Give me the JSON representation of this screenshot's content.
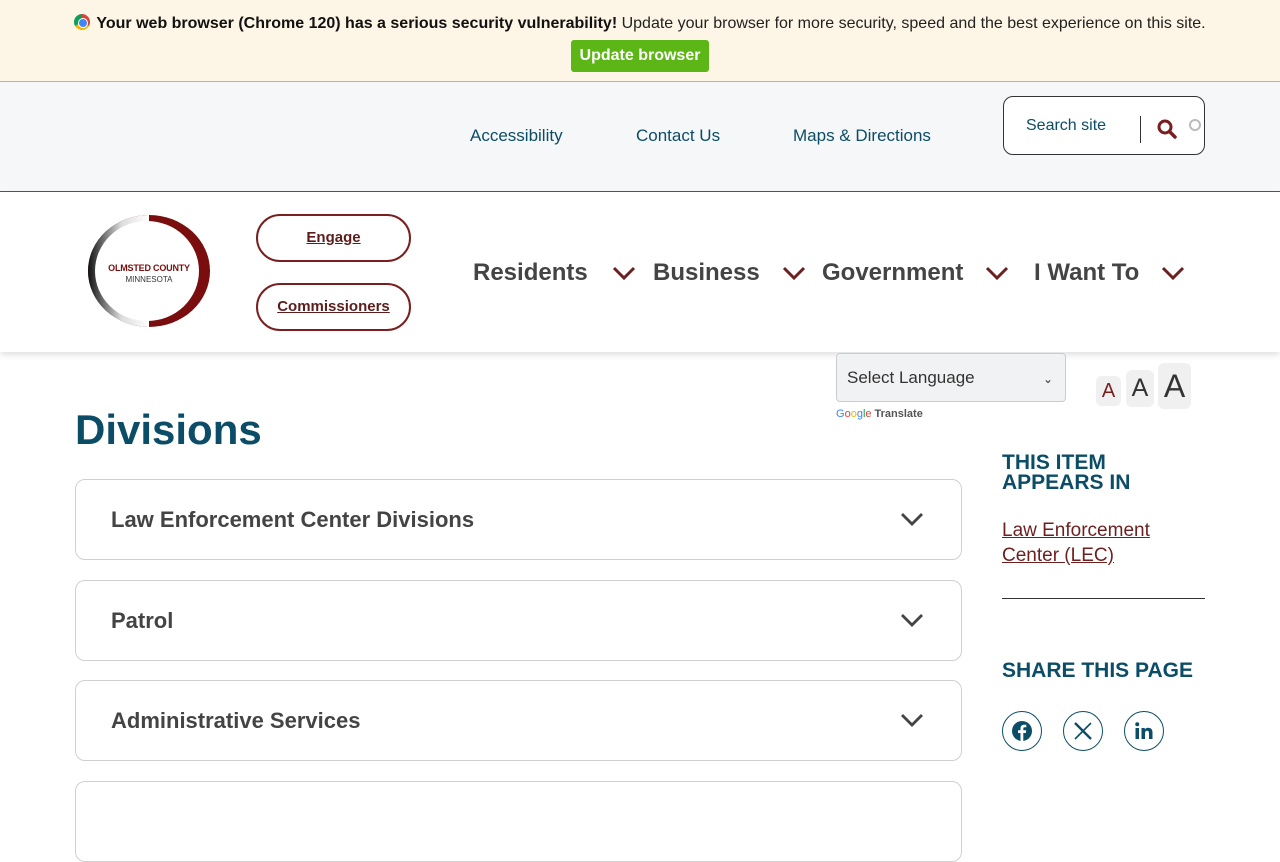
{
  "banner": {
    "bold_text": "Your web browser (Chrome 120) has a serious security vulnerability!",
    "text": " Update your browser for more security, speed and the best experience on this site.",
    "button_label": "Update browser"
  },
  "utility_nav": {
    "links": [
      "Accessibility",
      "Contact Us",
      "Maps & Directions"
    ],
    "search_placeholder": "Search site"
  },
  "header": {
    "logo": {
      "line1": "OLMSTED COUNTY",
      "line2": "MINNESOTA"
    },
    "pills": [
      "Engage",
      "Commissioners"
    ],
    "nav": [
      "Residents",
      "Business",
      "Government",
      "I Want To"
    ]
  },
  "language": {
    "selected": "Select Language",
    "powered_by": "Translate"
  },
  "font_sizes": [
    "A",
    "A",
    "A"
  ],
  "page": {
    "title": "Divisions",
    "accordion": [
      "Law Enforcement Center Divisions",
      "Patrol",
      "Administrative Services"
    ]
  },
  "sidebar": {
    "appears_heading": "THIS ITEM APPEARS IN",
    "appears_link": "Law Enforcement Center (LEC)",
    "share_heading": "SHARE THIS PAGE",
    "share_icons": [
      "facebook-icon",
      "x-icon",
      "linkedin-icon"
    ]
  },
  "colors": {
    "primary": "#0b4d66",
    "accent": "#6e1f1f",
    "banner_bg": "#fdf6e6",
    "update_green": "#5cb615"
  }
}
